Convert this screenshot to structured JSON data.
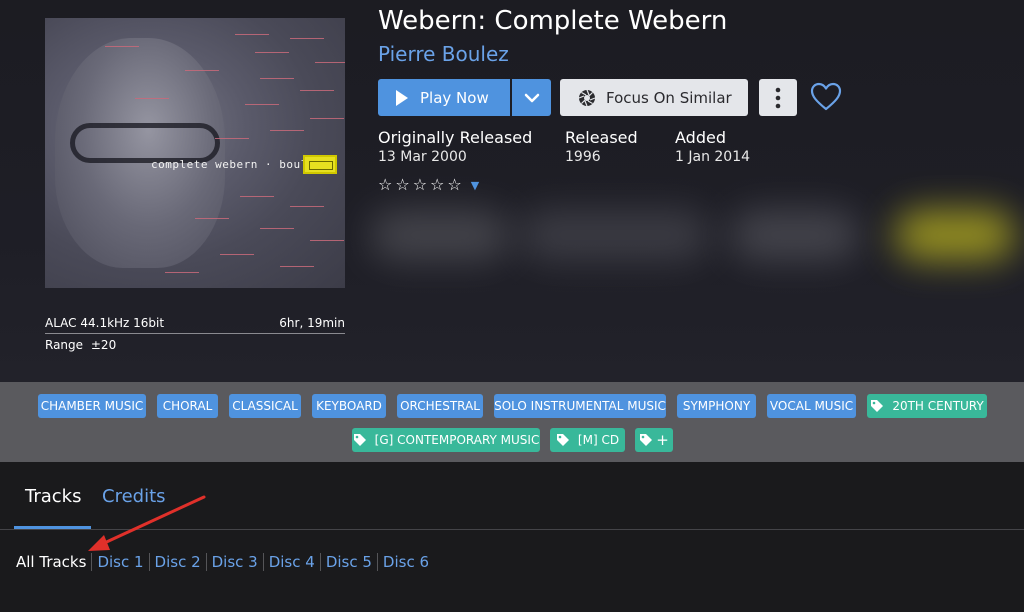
{
  "album": {
    "title": "Webern: Complete Webern",
    "artist": "Pierre Boulez",
    "cover_text": "complete webern · boulez"
  },
  "format": {
    "codec": "ALAC 44.1kHz 16bit",
    "duration": "6hr, 19min",
    "range_label": "Range",
    "range_value": "±20"
  },
  "actions": {
    "play_label": "Play Now",
    "focus_label": "Focus On Similar"
  },
  "info": {
    "originally_released_label": "Originally Released",
    "originally_released_value": "13 Mar 2000",
    "released_label": "Released",
    "released_value": "1996",
    "added_label": "Added",
    "added_value": "1 Jan 2014"
  },
  "rating": {
    "stars": 0,
    "max": 5
  },
  "genres": {
    "row1": [
      "CHAMBER MUSIC",
      "CHORAL",
      "CLASSICAL",
      "KEYBOARD",
      "ORCHESTRAL",
      "SOLO INSTRUMENTAL MUSIC",
      "SYMPHONY",
      "VOCAL MUSIC"
    ],
    "row1_tag": "20TH CENTURY",
    "row2_tags": [
      "[G] CONTEMPORARY MUSIC",
      "[M] CD"
    ],
    "add_label": "+"
  },
  "tabs": {
    "tracks": "Tracks",
    "credits": "Credits"
  },
  "discs": [
    "All Tracks",
    "Disc 1",
    "Disc 2",
    "Disc 3",
    "Disc 4",
    "Disc 5",
    "Disc 6"
  ],
  "colors": {
    "accent": "#4f93df",
    "link": "#6aa2e8",
    "tag_teal": "#39b89a",
    "annotation_red": "#e0302a"
  },
  "icons": {
    "play": "play-icon",
    "dropdown": "chevron-down-icon",
    "focus": "aperture-icon",
    "more": "more-vertical-icon",
    "favorite": "heart-icon",
    "tag": "tag-icon"
  }
}
